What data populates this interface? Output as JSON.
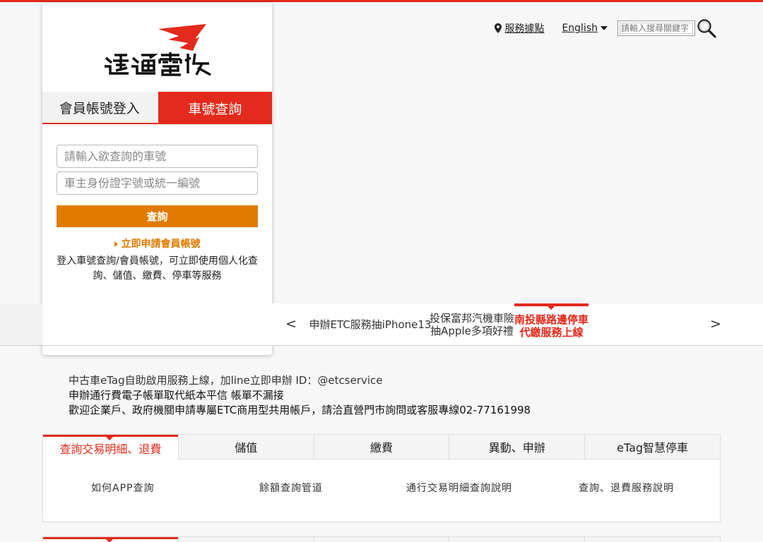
{
  "header": {
    "service_points": "服務據點",
    "language": "English",
    "search_placeholder": "請輸入搜尋關鍵字"
  },
  "brand": {
    "logo_text": "遠通電收",
    "accent_color": "#e32a1c",
    "orange_color": "#e07b00"
  },
  "login": {
    "tabs": [
      {
        "label": "會員帳號登入",
        "active": false
      },
      {
        "label": "車號查詢",
        "active": true
      }
    ],
    "plate_placeholder": "請輸入欲查詢的車號",
    "id_placeholder": "車主身份證字號或統一編號",
    "submit_label": "查詢",
    "apply_link": "立即申請會員帳號",
    "description": "登入車號查詢/會員帳號，可立即使用個人化查詢、儲值、繳費、停車等服務"
  },
  "news": {
    "prev": "<",
    "next": ">",
    "items": [
      {
        "text": "申辦ETC服務抽iPhone13",
        "active": false
      },
      {
        "text": "投保富邦汽機車險抽Apple多項好禮",
        "active": false
      },
      {
        "text": "南投縣路邊停車代繳服務上線",
        "active": true
      }
    ]
  },
  "notices": [
    "中古車eTag自助啟用服務上線，加line立即申辦 ID：@etcservice",
    "申辦通行費電子帳單取代紙本平信 帳單不漏接",
    "歡迎企業戶、政府機關申請專屬ETC商用型共用帳戶，請洽直營門市詢問或客服專線02-77161998"
  ],
  "services": {
    "tabs": [
      {
        "label": "查詢交易明細、退費",
        "active": true
      },
      {
        "label": "儲值",
        "active": false
      },
      {
        "label": "繳費",
        "active": false
      },
      {
        "label": "異動、申辦",
        "active": false
      },
      {
        "label": "eTag智慧停車",
        "active": false
      }
    ],
    "links": [
      "如何APP查詢",
      "餘額查詢管道",
      "通行交易明細查詢說明",
      "查詢、退費服務說明"
    ]
  }
}
